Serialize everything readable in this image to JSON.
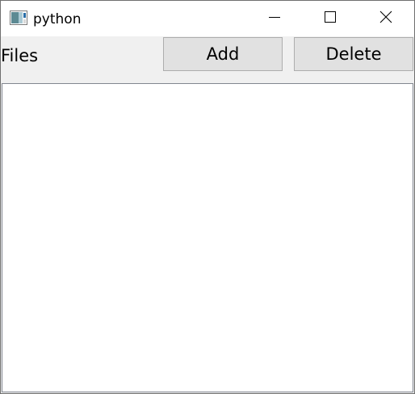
{
  "window": {
    "title": "python",
    "icon": "python-app-icon",
    "controls": {
      "minimize_icon": "minimize-icon",
      "maximize_icon": "maximize-icon",
      "close_icon": "close-icon"
    }
  },
  "toolbar": {
    "label": "Files",
    "add_label": "Add",
    "delete_label": "Delete"
  },
  "files": {
    "items": []
  },
  "colors": {
    "window_background": "#f0f0f0",
    "titlebar_background": "#ffffff",
    "button_background": "#e1e1e1",
    "button_border": "#adadad",
    "list_background": "#ffffff"
  }
}
